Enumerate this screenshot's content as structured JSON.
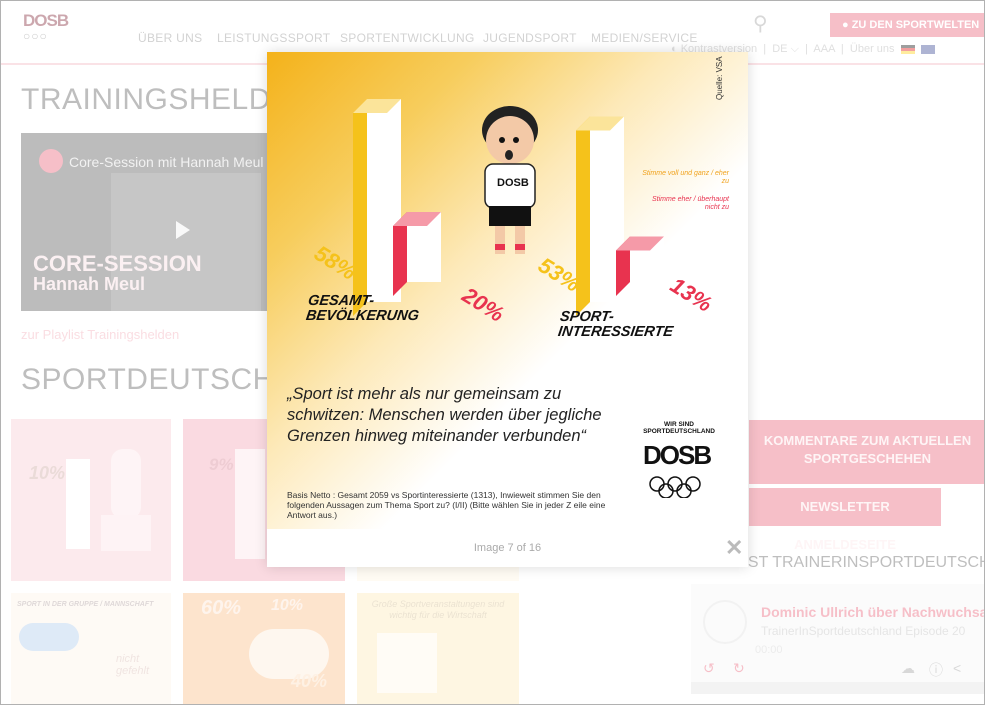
{
  "header": {
    "logo_text": "DOSB",
    "nav": [
      "ÜBER UNS",
      "LEISTUNGSSPORT",
      "SPORTENTWICKLUNG",
      "JUGENDSPORT",
      "MEDIEN/SERVICE"
    ],
    "cta_label": "ZU DEN SPORTWELTEN",
    "utility": {
      "contrast": "Kontrastversion",
      "language": "DE",
      "font_size": "AAA",
      "about": "Über uns"
    }
  },
  "sections": {
    "training_title": "TRAININGSHELDEN",
    "video": {
      "title": "Core-Session mit Hannah Meul",
      "overlay_line1": "CORE-SESSION",
      "overlay_line2": "Hannah Meul"
    },
    "playlist_link": "zur Playlist Trainingshelden",
    "sportdeutschland_title": "SPORTDEUTSCHLAN"
  },
  "sidebar": {
    "kommentare_button": "KOMMENTARE ZUM AKTUELLEN SPORTGESCHEHEN",
    "newsletter_button": "NEWSLETTER ANMELDESEITE",
    "podcast_title": "PODCAST TRAINERINSPORTDEUTSCHLAND",
    "player": {
      "episode_title": "Dominic Ullrich über Nachwuchsar...",
      "episode_sub": "TrainerInSportdeutschland Episode 20",
      "time": "00:00"
    }
  },
  "tiles": {
    "tile1_pct": "10%",
    "tile2_pct": "9%",
    "tile5_header": "SPORT IN DER GRUPPE / MANNSCHAFT",
    "tile5_label": "nicht gefehlt",
    "tile6_pct1": "60%",
    "tile6_pct2": "10%",
    "tile6_pct3": "40%",
    "tile7_header": "Große Sportveranstaltungen sind wichtig für die Wirtschaft"
  },
  "lightbox": {
    "caption": "Image 7 of 16",
    "close_icon": "close-icon",
    "source": "Quelle: VSA",
    "legend1": "Stimme voll und ganz / eher zu",
    "legend2": "Stimme eher / überhaupt nicht zu",
    "group1_label": [
      "GESAMT-",
      "BEVÖLKERUNG"
    ],
    "group2_label": [
      "SPORT-",
      "INTERESSIERTE"
    ],
    "character_shirt": "DOSB",
    "quote": "„Sport ist mehr als nur gemeinsam zu schwitzen: Menschen werden über jegliche Grenzen hinweg miteinander verbunden“",
    "basis": "Basis Netto : Gesamt 2059 vs Sportinteressierte (1313), Inwieweit stimmen Sie den folgenden Aussagen zum Thema Sport zu? (I/II) (Bitte wählen Sie in jeder Z eile eine Antwort aus.)",
    "brand_top": "WIR SIND SPORTDEUTSCHLAND",
    "brand_logo": "DOSB"
  },
  "chart_data": {
    "type": "bar",
    "categories": [
      "GESAMT-BEVÖLKERUNG",
      "SPORT-INTERESSIERTE"
    ],
    "series": [
      {
        "name": "Stimme voll und ganz / eher zu",
        "values": [
          58,
          53
        ]
      },
      {
        "name": "Stimme eher / überhaupt nicht zu",
        "values": [
          20,
          13
        ]
      }
    ],
    "labels": [
      "58%",
      "20%",
      "53%",
      "13%"
    ],
    "colors": {
      "agree": "#f5c21b",
      "disagree": "#e8334f"
    }
  }
}
